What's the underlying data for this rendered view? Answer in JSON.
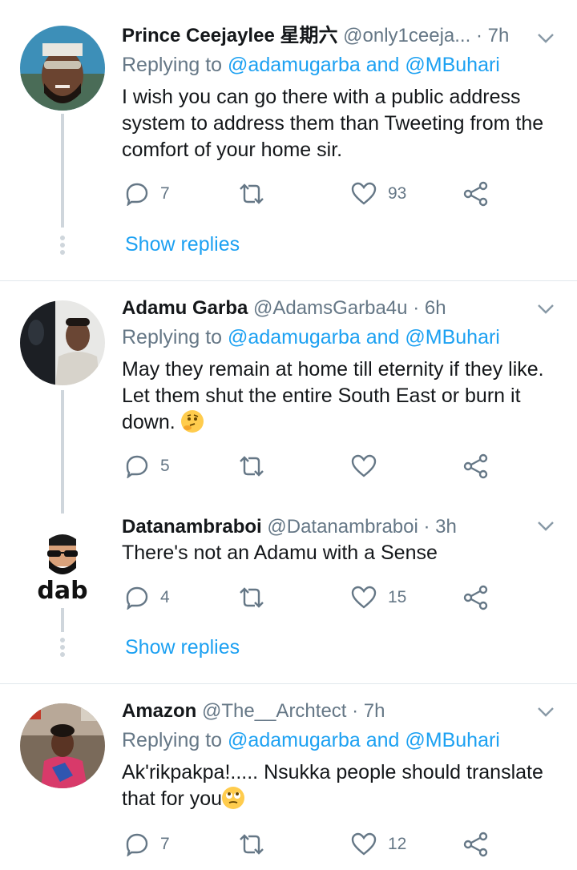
{
  "tweets": [
    {
      "name": "Prince Ceejaylee 星期六",
      "handle": "@only1ceeja...",
      "time": "· 7h",
      "replying_prefix": "Replying to ",
      "replying_links": "@adamugarba and @MBuhari",
      "text": "I wish you can go there with a public address system to address them than Tweeting from the comfort of your home sir.",
      "reply_count": "7",
      "retweet_count": "",
      "like_count": "93",
      "show_replies": "Show replies"
    },
    {
      "name": "Adamu Garba",
      "handle": "@AdamsGarba4u",
      "time": "· 6h",
      "replying_prefix": "Replying to ",
      "replying_links": "@adamugarba and @MBuhari",
      "text": "May they remain at home till eternity if they like. Let them shut the entire South East or burn it down. ",
      "reply_count": "5",
      "retweet_count": "",
      "like_count": ""
    },
    {
      "name": "Datanambraboi",
      "handle": "@Datanambraboi",
      "time": "· 3h",
      "text": "There's not an Adamu with a Sense",
      "reply_count": "4",
      "retweet_count": "",
      "like_count": "15",
      "show_replies": "Show replies",
      "avatar_logo_text": "dab"
    },
    {
      "name": "Amazon",
      "handle": "@The__Archtect",
      "time": "· 7h",
      "replying_prefix": "Replying to ",
      "replying_links": "@adamugarba and @MBuhari",
      "text": "Ak'rikpakpa!..... Nsukka people should translate that for you",
      "reply_count": "7",
      "retweet_count": "",
      "like_count": "12"
    }
  ],
  "icons": {
    "reply": "reply-icon",
    "retweet": "retweet-icon",
    "like": "like-icon",
    "share": "share-icon",
    "caret": "chevron-down-icon",
    "emoji_thinking": "thinking-face-emoji",
    "emoji_eyeroll": "eye-roll-emoji"
  },
  "colors": {
    "link": "#1da1f2",
    "muted": "#657786",
    "text": "#14171a",
    "divider": "#e1e8ed",
    "thread_line": "#cfd6dc"
  }
}
